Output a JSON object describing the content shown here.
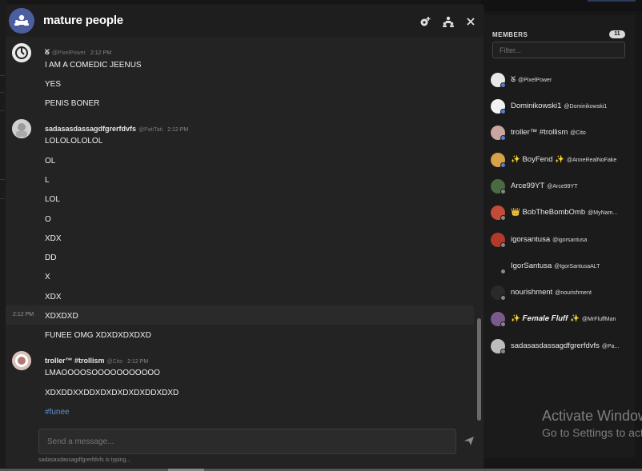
{
  "chat": {
    "title": "mature people",
    "composer_placeholder": "Send a message...",
    "typing_indicator": "sadasasdassagdfgrerfdvfs is typing...",
    "messages": [
      {
        "user": "ᘜ",
        "handle": "@PixelPower",
        "time": "2:12 PM",
        "lines": [
          "I AM A COMEDIC JEENUS",
          "YES",
          "PENIS BONER"
        ]
      },
      {
        "user": "sadasasdassagdfgrerfdvfs",
        "handle": "@PatiTati",
        "time": "2:12 PM",
        "lines": [
          "LOLOLOLOLOL",
          "OL",
          "L",
          "LOL",
          "O",
          "XDX",
          "DD",
          "X",
          "XDX",
          "XDXDXD",
          "FUNEE OMG XDXDXDXDXD"
        ],
        "hover_time": "2:12 PM"
      },
      {
        "user": "troller™ #trollism",
        "handle": "@Cito",
        "time": "2:12 PM",
        "lines": [
          "LMAOOOOSOOOOOOOOOOO",
          "XDXDDXXDDXDXDXDXDXDDXDXD",
          "#funee"
        ]
      }
    ]
  },
  "members": {
    "title": "MEMBERS",
    "count": "11",
    "filter_placeholder": "Filter...",
    "list": [
      {
        "name": "ᘜ",
        "handle": "@PixelPower",
        "status": "idle",
        "status_color": "#5b7bd5",
        "avatar": "#e8e8e8"
      },
      {
        "name": "Dominikowski1",
        "handle": "@Dominikowski1",
        "status": "online",
        "status_color": "#5b7bd5",
        "avatar": "#f2f2f2"
      },
      {
        "name": "troller™ #trollism",
        "handle": "@Cito",
        "status": "online",
        "status_color": "#5b7bd5",
        "avatar": "#c9a7a0"
      },
      {
        "name": "✨ BoyFend ✨",
        "handle": "@AnneRealNoFake",
        "status": "online",
        "status_color": "#5b7bd5",
        "avatar": "#d7a04a"
      },
      {
        "name": "Arce99YT",
        "handle": "@Arce99YT",
        "status": "offline",
        "status_color": "#888888",
        "avatar": "#4a6a3f"
      },
      {
        "name": "👑 BobTheBombOmb",
        "handle": "@MyNam...",
        "status": "offline",
        "status_color": "#888888",
        "avatar": "#c44a3a"
      },
      {
        "name": "igorsantusa",
        "handle": "@igorsantusa",
        "status": "offline",
        "status_color": "#888888",
        "avatar": "#b33a2a"
      },
      {
        "name": "IgorSantusa",
        "handle": "@IgorSantusaALT",
        "status": "offline",
        "status_color": "#888888",
        "avatar": "#1b1b1b"
      },
      {
        "name": "nourishment",
        "handle": "@nourishment",
        "status": "offline",
        "status_color": "#888888",
        "avatar": "#2a2a2a"
      },
      {
        "name": "✨ 𝑭𝒆𝒎𝒂𝒍𝒆 𝑭𝒍𝒖𝒇𝒇 ✨",
        "handle": "@MrFluffMan",
        "status": "offline",
        "status_color": "#888888",
        "avatar": "#7a5a8a"
      },
      {
        "name": "sadasasdassagdfgrerfdvfs",
        "handle": "@Pa...",
        "status": "offline",
        "status_color": "#888888",
        "avatar": "#bdbdbd"
      }
    ]
  },
  "watermark": {
    "line1": "Activate Windows",
    "line2": "Go to Settings to activate Windows."
  }
}
